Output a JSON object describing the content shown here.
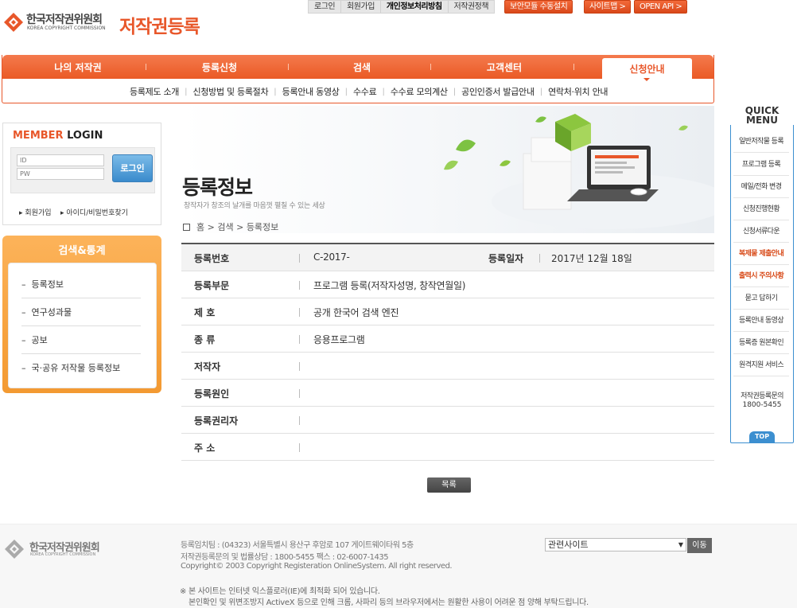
{
  "header": {
    "logo_kr": "한국저작권위원회",
    "logo_en": "KOREA COPYRIGHT COMMISSION",
    "site_title": "저작권등록"
  },
  "util_links": [
    "로그인",
    "회원가입",
    "개인정보처리방침",
    "저작권정책"
  ],
  "util_buttons": {
    "security": "보안모듈 수동설치",
    "sitemap": "사이트맵 >",
    "open_api": "OPEN API >"
  },
  "gnb": {
    "items": [
      "나의 저작권",
      "등록신청",
      "검색",
      "고객센터"
    ],
    "active": "신청안내",
    "sub_items": [
      "등록제도 소개",
      "신청방법 및 등록절차",
      "등록안내 동영상",
      "수수료",
      "수수료 모의계산",
      "공인인증서 발급안내",
      "연락처·위치 안내"
    ]
  },
  "login": {
    "title_colored": "MEMBER",
    "title_rest": " LOGIN",
    "id_placeholder": "ID",
    "pw_placeholder": "PW",
    "button": "로그인",
    "join": "회원가입",
    "find": "아이디/비밀번호찾기"
  },
  "stats": {
    "title": "검색&통계",
    "items": [
      "등록정보",
      "연구성과물",
      "공보",
      "국·공유 저작물 등록정보"
    ]
  },
  "page": {
    "title": "등록정보",
    "subtitle": "창작자가 창조의 날개를 마음껏 펼칠 수 있는 세상",
    "breadcrumb": [
      "홈",
      "검색",
      "등록정보"
    ]
  },
  "detail": {
    "rows": [
      {
        "label": "등록번호",
        "value": "C-2017-",
        "label2": "등록일자",
        "value2": "2017년 12월 18일"
      },
      {
        "label": "등록부문",
        "value": "프로그램 등록(저작자성명, 창작연월일)"
      },
      {
        "label": "제 호",
        "value": "공개 한국어 검색 엔진"
      },
      {
        "label": "종 류",
        "value": "응용프로그램"
      },
      {
        "label": "저작자",
        "value": ""
      },
      {
        "label": "등록원인",
        "value": ""
      },
      {
        "label": "등록권리자",
        "value": ""
      },
      {
        "label": "주 소",
        "value": ""
      }
    ],
    "list_button": "목록"
  },
  "quick_menu": {
    "title_line1": "QUICK",
    "title_line2": "MENU",
    "items": [
      "일반저작물 등록",
      "프로그램 등록",
      "메일/전화 변경",
      "신청진행현황",
      "신청서류다운",
      "복제물 제출안내",
      "출력시 주의사항",
      "묻고 답하기",
      "등록안내 동영상",
      "등록증 원본확인",
      "원격지원 서비스"
    ],
    "highlight_items": [
      "복제물 제출안내",
      "출력시 주의사항"
    ],
    "phone_label": "저작권등록문의",
    "phone": "1800-5455",
    "top": "TOP"
  },
  "footer": {
    "logo_kr": "한국저작권위원회",
    "logo_en": "KOREA COPYRIGHT COMMISSION",
    "address": "등록임치팀 : (04323) 서울특별시 용산구 후암로 107 게이트웨이타워 5층",
    "contact": "저작권등록문의 및 법률상담 : 1800-5455    팩스 : 02-6007-1435",
    "copyright": "Copyright© 2003 Copyright Registeration OnlineSystem. All right reserved.",
    "related_select": "관련사이트",
    "go_button": "이동",
    "notice1": "※ 본 사이트는 인터넷 익스플로러(IE)에 최적화 되어 있습니다.",
    "notice2": "본인확인 및 위변조방지 ActiveX 등으로 인해 크롬, 사파리 등의 브라우저에서는 원활한 사용이 어려운 점 양해 부탁드립니다."
  },
  "colors": {
    "brand_orange": "#e8572a",
    "accent_blue": "#3c8fd0",
    "stats_orange": "#f7a33f"
  }
}
